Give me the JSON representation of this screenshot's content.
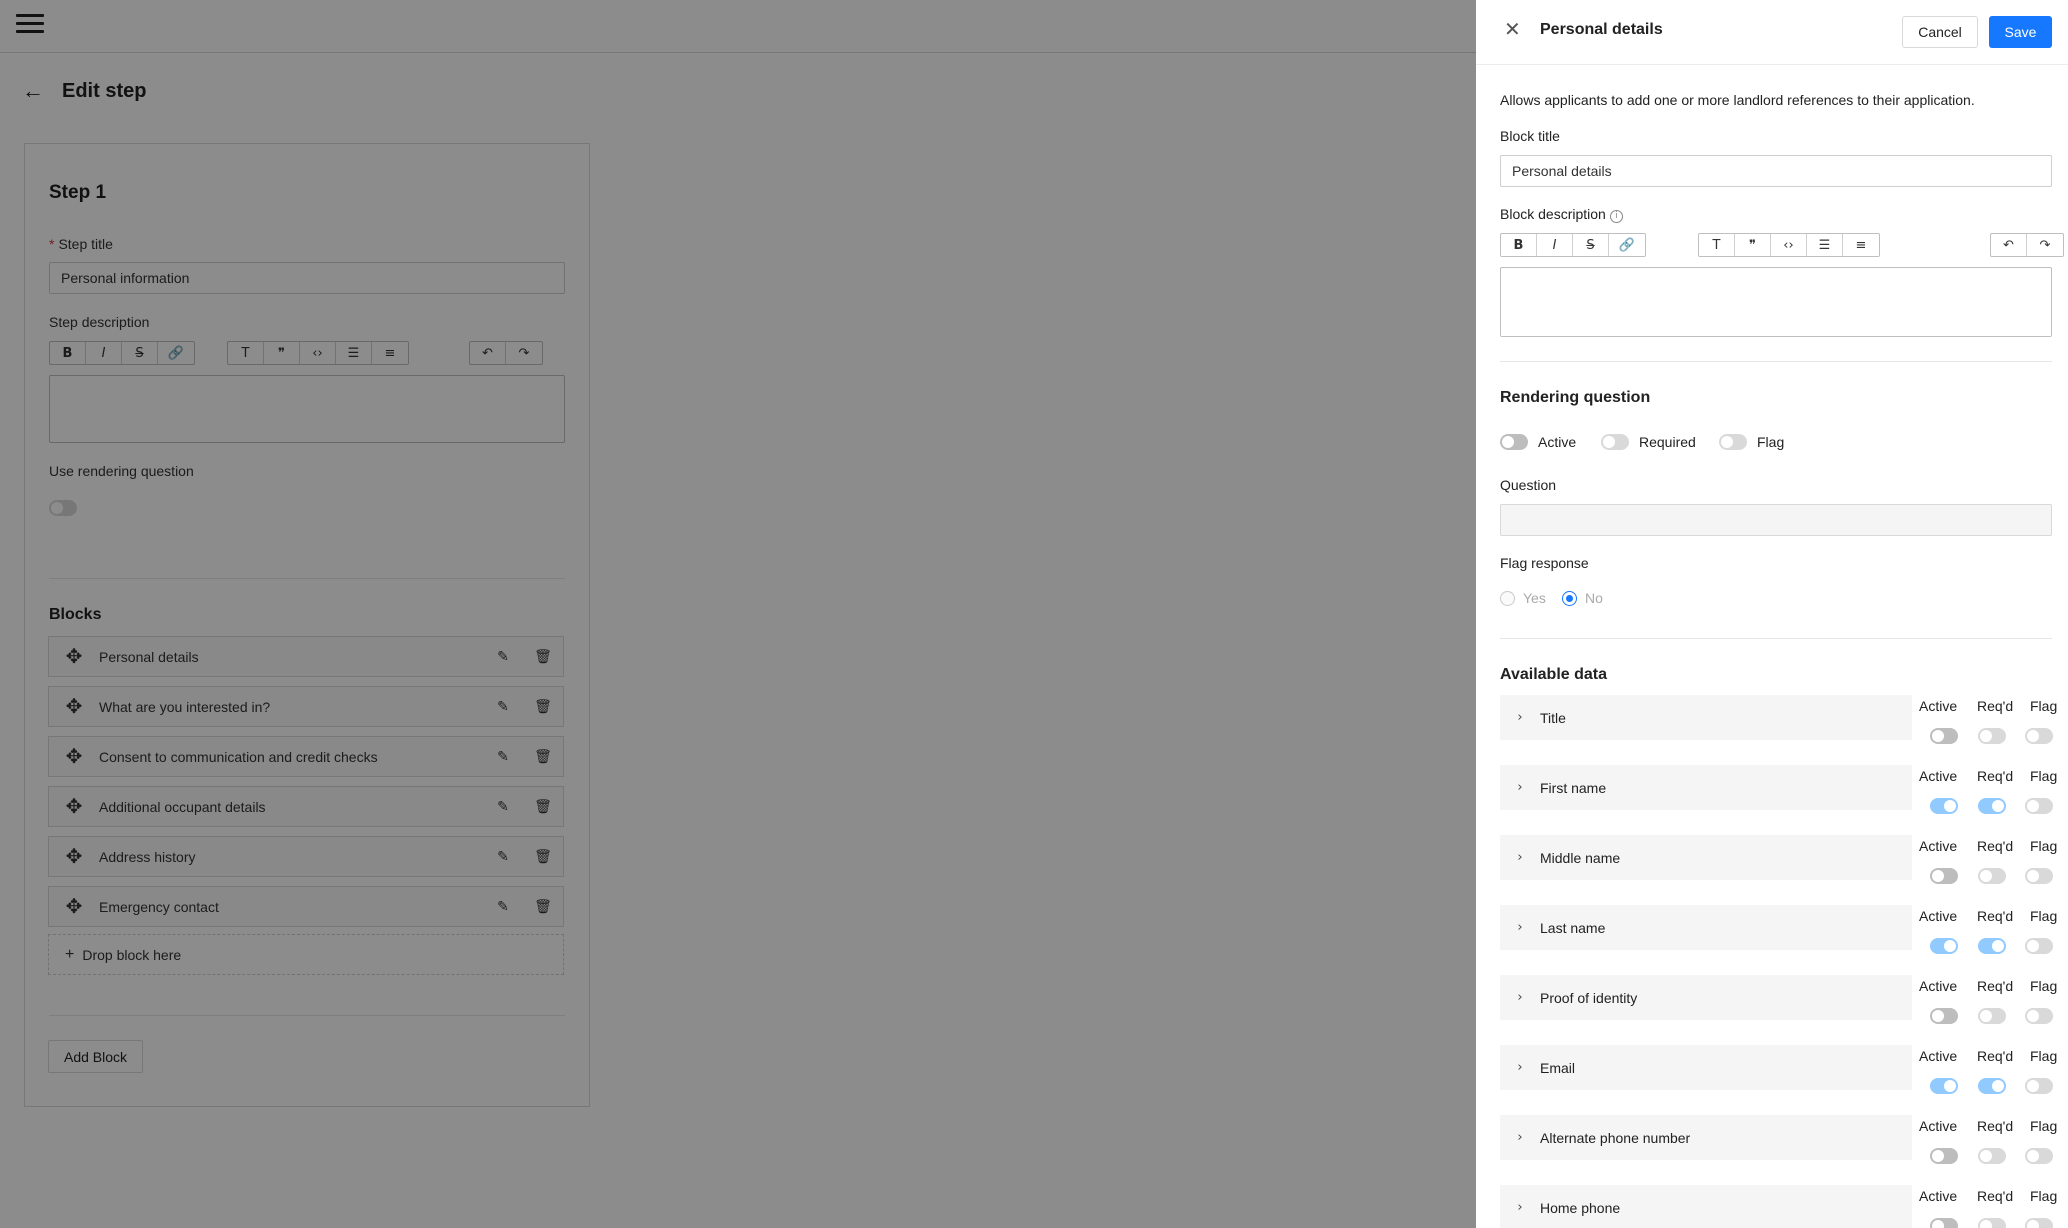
{
  "page": {
    "title": "Edit step"
  },
  "step": {
    "heading": "Step 1",
    "title_label": "Step title",
    "title_value": "Personal information",
    "description_label": "Step description",
    "rendering_label": "Use rendering question",
    "blocks_heading": "Blocks",
    "blocks": [
      "Personal details",
      "What are you interested in?",
      "Consent to communication and credit checks",
      "Additional occupant details",
      "Address history",
      "Emergency contact"
    ],
    "drop_label": "Drop block here",
    "add_block_label": "Add Block"
  },
  "toolbar": {
    "icons": [
      "bold-icon",
      "italic-icon",
      "strikethrough-icon",
      "link-icon",
      "heading-icon",
      "quote-icon",
      "code-icon",
      "bullet-list-icon",
      "numbered-list-icon",
      "undo-icon",
      "redo-icon"
    ],
    "glyphs": [
      "B",
      "I",
      "S",
      "🔗",
      "T",
      "❞",
      "‹›",
      "☰",
      "≡",
      "↶",
      "↷"
    ]
  },
  "drawer": {
    "title": "Personal details",
    "cancel_label": "Cancel",
    "save_label": "Save",
    "intro": "Allows applicants to add one or more landlord references to their application.",
    "block_title_label": "Block title",
    "block_title_value": "Personal details",
    "block_description_label": "Block description",
    "rendering_heading": "Rendering question",
    "toggle_active": "Active",
    "toggle_required": "Required",
    "toggle_flag": "Flag",
    "question_label": "Question",
    "flag_response_label": "Flag response",
    "radio_yes": "Yes",
    "radio_no": "No",
    "radio_selected": "No",
    "available_heading": "Available data",
    "col_active": "Active",
    "col_required": "Req'd",
    "col_flag": "Flag",
    "fields": [
      {
        "name": "Title",
        "active": false,
        "required": false,
        "flag": false
      },
      {
        "name": "First name",
        "active": true,
        "required": true,
        "flag": false
      },
      {
        "name": "Middle name",
        "active": false,
        "required": false,
        "flag": false
      },
      {
        "name": "Last name",
        "active": true,
        "required": true,
        "flag": false
      },
      {
        "name": "Proof of identity",
        "active": false,
        "required": false,
        "flag": false
      },
      {
        "name": "Email",
        "active": true,
        "required": true,
        "flag": false
      },
      {
        "name": "Alternate phone number",
        "active": false,
        "required": false,
        "flag": false
      },
      {
        "name": "Home phone",
        "active": false,
        "required": false,
        "flag": false
      }
    ]
  },
  "colors": {
    "primary": "#1677ff",
    "mask": "rgba(0,0,0,0.45)"
  }
}
